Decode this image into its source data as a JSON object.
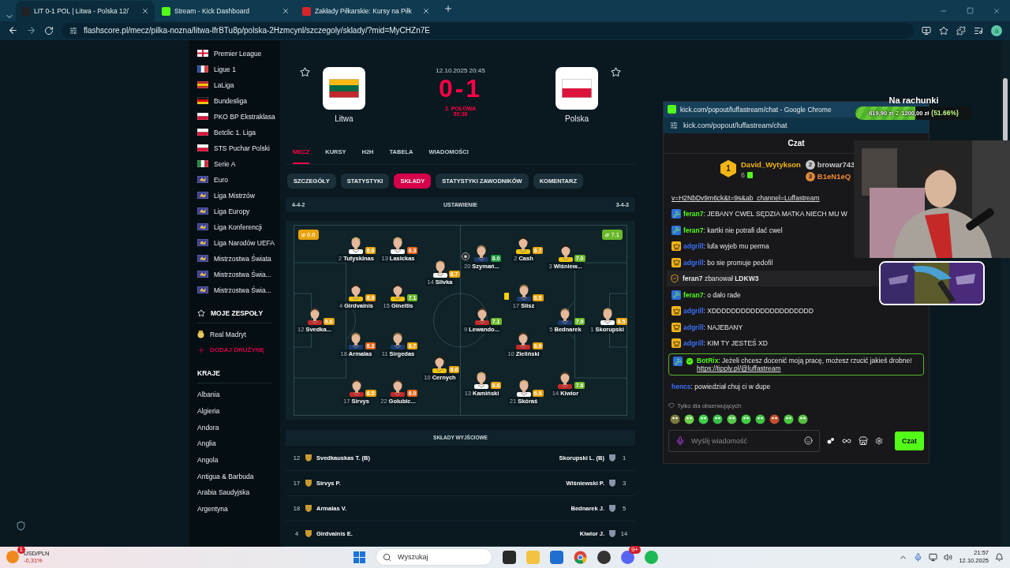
{
  "browser": {
    "tabs": [
      {
        "title": "LIT 0-1 POL | Litwa - Polska 12/",
        "kind": "flashscore",
        "selected": true
      },
      {
        "title": "Stream - Kick Dashboard",
        "kind": "kick",
        "selected": false
      },
      {
        "title": "Zakłady Piłkarskie: Kursy na Piłk",
        "kind": "bet",
        "selected": false
      }
    ],
    "url": "flashscore.pl/mecz/pilka-nozna/litwa-lfrBTu8p/polska-2Hzmcynl/szczegoly/sklady/?mid=MyCHZn7E",
    "profile": "a"
  },
  "sidebar": {
    "leagues": [
      {
        "name": "Premier League",
        "kind": "england"
      },
      {
        "name": "Ligue 1",
        "kind": "france"
      },
      {
        "name": "LaLiga",
        "kind": "spain"
      },
      {
        "name": "Bundesliga",
        "kind": "germany"
      },
      {
        "name": "PKO BP Ekstraklasa",
        "kind": "poland"
      },
      {
        "name": "Betclic 1. Liga",
        "kind": "poland"
      },
      {
        "name": "STS Puchar Polski",
        "kind": "poland"
      },
      {
        "name": "Serie A",
        "kind": "italy"
      },
      {
        "name": "Euro",
        "kind": "uefa"
      },
      {
        "name": "Liga Mistrzów",
        "kind": "uefa"
      },
      {
        "name": "Liga Europy",
        "kind": "uefa"
      },
      {
        "name": "Liga Konferencji",
        "kind": "uefa"
      },
      {
        "name": "Liga Narodów UEFA",
        "kind": "uefa"
      },
      {
        "name": "Mistrzostwa Świata",
        "kind": "uefa"
      },
      {
        "name": "Mistrzostwa Świa...",
        "kind": "uefa"
      },
      {
        "name": "Mistrzostwa Świa...",
        "kind": "uefa"
      }
    ],
    "my_teams": {
      "title": "MOJE ZESPOŁY",
      "teams": [
        "Real Madryt"
      ],
      "add": "DODAJ DRUŻYNĘ"
    },
    "countries": {
      "title": "KRAJE",
      "items": [
        "Albania",
        "Algieria",
        "Andora",
        "Anglia",
        "Angola",
        "Antigua & Barbuda",
        "Arabia Saudyjska",
        "Argentyna"
      ]
    }
  },
  "match": {
    "home": {
      "name": "Litwa",
      "kind": "lithuania"
    },
    "away": {
      "name": "Polska",
      "kind": "poland"
    },
    "date": "12.10.2025 20:45",
    "score": "0-1",
    "status": "2. POŁOWA",
    "clock": "50:38"
  },
  "tabs": [
    {
      "label": "MECZ",
      "selected": true
    },
    {
      "label": "KURSY",
      "selected": false
    },
    {
      "label": "H2H",
      "selected": false
    },
    {
      "label": "TABELA",
      "selected": false
    },
    {
      "label": "WIADOMOŚCI",
      "selected": false
    }
  ],
  "subtabs": [
    {
      "label": "SZCZEGÓŁY",
      "selected": false
    },
    {
      "label": "STATYSTYKI",
      "selected": false
    },
    {
      "label": "SKŁADY",
      "selected": true
    },
    {
      "label": "STATYSTYKI ZAWODNIKÓW",
      "selected": false
    },
    {
      "label": "KOMENTARZ",
      "selected": false
    }
  ],
  "formation": {
    "home": "4-4-2",
    "title": "USTAWIENIE",
    "away": "3-4-3"
  },
  "pitch": {
    "home_average": {
      "label": "⌀ 6.6",
      "color": "#e9a30c"
    },
    "away_average": {
      "label": "⌀ 7.1",
      "color": "#6ab82a"
    },
    "home_lines": [
      [
        {
          "number": "12",
          "name": "Svedka...",
          "rating": "6.6",
          "color": "#e9a30c"
        }
      ],
      [
        {
          "number": "2",
          "name": "Tutyskinas",
          "rating": "6.6",
          "color": "#e9a30c"
        },
        {
          "number": "4",
          "name": "Girdvainis",
          "rating": "6.9",
          "color": "#e9a30c"
        },
        {
          "number": "18",
          "name": "Armalas",
          "rating": "6.3",
          "color": "#e8651a"
        },
        {
          "number": "17",
          "name": "Sirvys",
          "rating": "6.5",
          "color": "#e9a30c"
        }
      ],
      [
        {
          "number": "13",
          "name": "Lasickas",
          "rating": "6.3",
          "color": "#e8651a"
        },
        {
          "number": "15",
          "name": "Gineitis",
          "rating": "7.1",
          "color": "#6ab82a"
        },
        {
          "number": "11",
          "name": "Sirgedas",
          "rating": "6.7",
          "color": "#e9a30c"
        },
        {
          "number": "22",
          "name": "Golubic...",
          "rating": "6.0",
          "color": "#e8651a"
        }
      ],
      [
        {
          "number": "14",
          "name": "Slivka",
          "rating": "6.7",
          "color": "#e9a30c"
        },
        {
          "number": "10",
          "name": "Cernych",
          "rating": "6.6",
          "color": "#e9a30c"
        }
      ]
    ],
    "away_lines": [
      [
        {
          "number": "20",
          "name": "Szymań...",
          "rating": "8.0",
          "color": "#1f9a3e",
          "goal": true
        },
        {
          "number": "9",
          "name": "Lewando...",
          "rating": "7.1",
          "color": "#6ab82a"
        },
        {
          "number": "13",
          "name": "Kamiński",
          "rating": "6.6",
          "color": "#e9a30c"
        }
      ],
      [
        {
          "number": "2",
          "name": "Cash",
          "rating": "6.7",
          "color": "#e9a30c"
        },
        {
          "number": "17",
          "name": "Slisz",
          "rating": "6.5",
          "color": "#e9a30c",
          "yellow_card": true
        },
        {
          "number": "10",
          "name": "Zieliński",
          "rating": "6.9",
          "color": "#e9a30c"
        },
        {
          "number": "21",
          "name": "Skóraś",
          "rating": "6.9",
          "color": "#e9a30c"
        }
      ],
      [
        {
          "number": "3",
          "name": "Wiśniew...",
          "rating": "7.0",
          "color": "#6ab82a"
        },
        {
          "number": "5",
          "name": "Bednarek",
          "rating": "7.9",
          "color": "#6ab82a"
        },
        {
          "number": "14",
          "name": "Kiwior",
          "rating": "7.6",
          "color": "#6ab82a"
        }
      ],
      [
        {
          "number": "1",
          "name": "Skorupski",
          "rating": "6.5",
          "color": "#e9a30c"
        }
      ]
    ]
  },
  "starting": {
    "title": "SKŁADY WYJŚCIOWE",
    "rows": [
      {
        "home_number": "12",
        "home_name": "Svedkauskas T. (B)",
        "away_name": "Skorupski L. (B)",
        "away_number": "1"
      },
      {
        "home_number": "17",
        "home_name": "Sirvys P.",
        "away_name": "Wiśniewski P.",
        "away_number": "3"
      },
      {
        "home_number": "18",
        "home_name": "Armalas V.",
        "away_name": "Bednarek J.",
        "away_number": "5"
      },
      {
        "home_number": "4",
        "home_name": "Girdvainis E.",
        "away_name": "Kiwior J.",
        "away_number": "14"
      }
    ]
  },
  "chat": {
    "window_title": "kick.com/popout/luffastream/chat - Google Chrome",
    "url": "kick.com/popout/luffastream/chat",
    "title": "Czat",
    "leaders": [
      {
        "rank": "1",
        "name": "David_Wytykson",
        "count": "6"
      },
      {
        "rank": "2",
        "name": "browar743"
      },
      {
        "rank": "3",
        "name": "B1eN1eQ"
      }
    ],
    "top_link": "v=H2NbDv9m6ck&t=9s&ab_channel=Luffastream",
    "messages": [
      {
        "kind": "message",
        "moderator": true,
        "crown": false,
        "user": "feran7",
        "color": "#53fc18",
        "text": ": JEBANY CWEL SĘDZIA MATKA NIECH MU W"
      },
      {
        "kind": "message",
        "moderator": true,
        "crown": false,
        "user": "feran7",
        "color": "#53fc18",
        "text": ": kartki nie potrafi dać cwel"
      },
      {
        "kind": "message",
        "moderator": false,
        "crown": true,
        "user": "adgrill",
        "color": "#3d6ef5",
        "text": ": lufa wyjeb mu perma"
      },
      {
        "kind": "message",
        "moderator": false,
        "crown": true,
        "user": "adgrill",
        "color": "#3d6ef5",
        "text": ": bo sie promuje pedofil"
      },
      {
        "kind": "ban",
        "text": "**feran7** zbanował **LDKW3**"
      },
      {
        "kind": "message",
        "moderator": true,
        "crown": false,
        "user": "feran7",
        "color": "#53fc18",
        "text": ": o dało rade"
      },
      {
        "kind": "message",
        "moderator": false,
        "crown": true,
        "user": "adgrill",
        "color": "#3d6ef5",
        "text": ": XDDDDDDDDDDDDDDDDDDDDD"
      },
      {
        "kind": "message",
        "moderator": false,
        "crown": true,
        "user": "adgrill",
        "color": "#3d6ef5",
        "text": ": NAJEBANY"
      },
      {
        "kind": "message",
        "moderator": false,
        "crown": true,
        "user": "adgrill",
        "color": "#3d6ef5",
        "text": ": KIM TY JESTEŚ XD"
      },
      {
        "kind": "highlight",
        "moderator": true,
        "crown": false,
        "verified": true,
        "user": "BotRix",
        "color": "#53fc18",
        "text": ": Jeżeli chcesz docenić moją pracę, możesz rzucić jakieś drobne!",
        "link": "https://tipply.pl/@luffastream"
      },
      {
        "kind": "message",
        "moderator": false,
        "crown": false,
        "user": "hencs",
        "color": "#3d6ef5",
        "text": ": powiedział chuj ci w dupe"
      }
    ],
    "mode": "Tylko dla obserwujących",
    "placeholder": "Wyślij wiadomość",
    "send": "Czat"
  },
  "goal": {
    "title": "Na rachunki",
    "amount": "619,90 zł",
    "separator": "z",
    "target": "1200,00 zł",
    "percent": "(51.66%)",
    "level": 0.5166
  },
  "taskbar": {
    "ticker_badge": "1",
    "ticker_symbol": "USD/PLN",
    "ticker_change": "-0,31%",
    "search_placeholder": "Wyszukaj",
    "discord_badge": "9+",
    "time": "21:57",
    "date": "12.10.2025"
  }
}
